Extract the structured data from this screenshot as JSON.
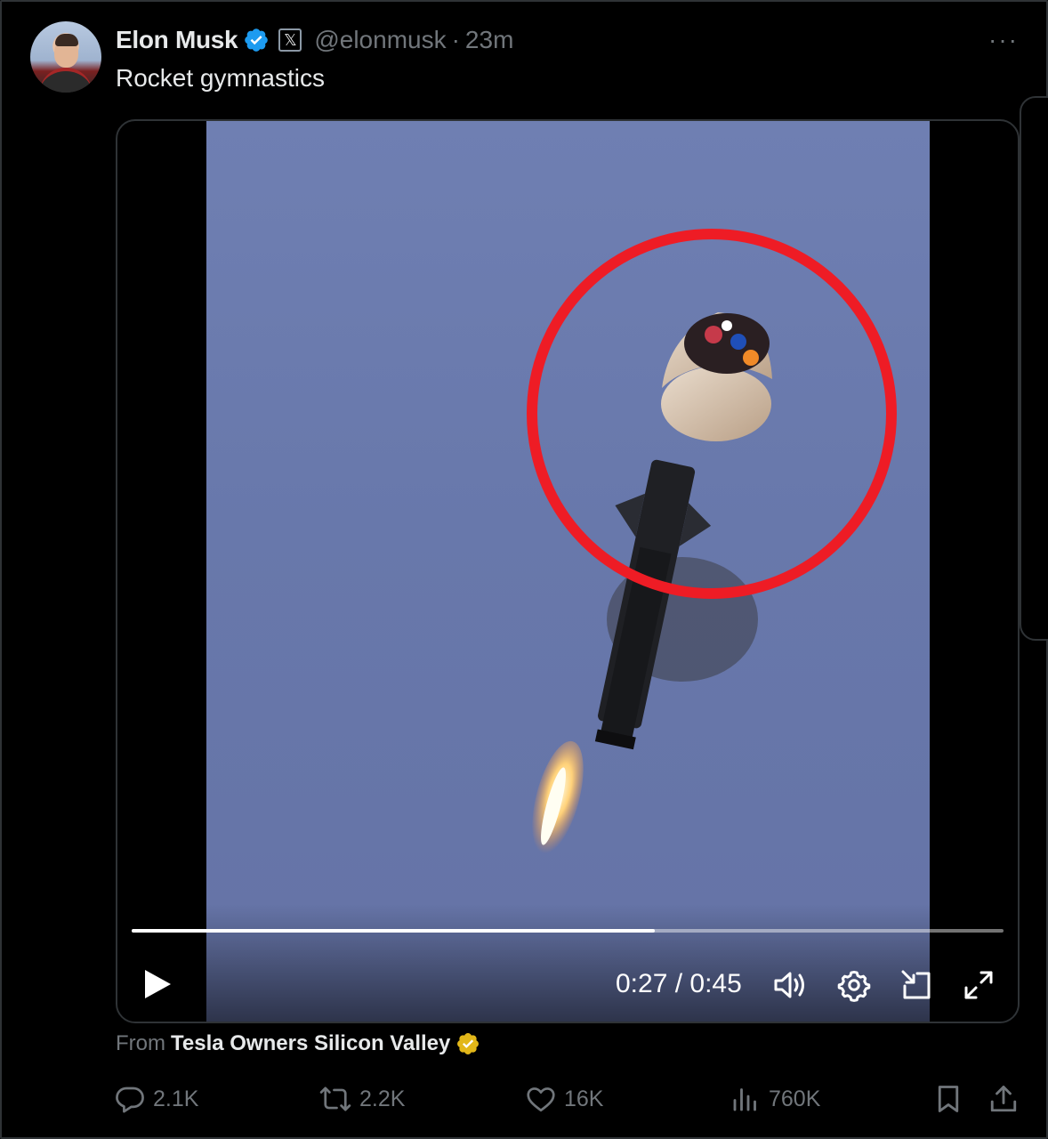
{
  "tweet": {
    "author_name": "Elon Musk",
    "x_badge": "𝕏",
    "handle": "@elonmusk",
    "separator": "·",
    "time": "23m",
    "more_glyph": "···",
    "text": "Rocket gymnastics"
  },
  "video": {
    "current_time": "0:27",
    "duration": "0:45",
    "time_display": "0:27 / 0:45",
    "progress_fraction": 0.6
  },
  "source": {
    "prefix": "From",
    "name": "Tesla Owners Silicon Valley"
  },
  "metrics": {
    "replies": "2.1K",
    "reposts": "2.2K",
    "likes": "16K",
    "views": "760K"
  },
  "colors": {
    "background": "#000000",
    "text_primary": "#e7e9ea",
    "text_secondary": "#71767b",
    "verified_blue": "#1d9bf0",
    "verified_gold": "#e2b719",
    "overlay_circle_red": "#ee1c25",
    "sky": "#6a79ad"
  },
  "icons": [
    "verified-badge-icon",
    "x-logo-icon",
    "more-icon",
    "play-icon",
    "volume-icon",
    "settings-icon",
    "pip-icon",
    "fullscreen-icon",
    "gold-verified-icon",
    "reply-icon",
    "retweet-icon",
    "like-icon",
    "views-icon",
    "bookmark-icon",
    "share-icon"
  ]
}
